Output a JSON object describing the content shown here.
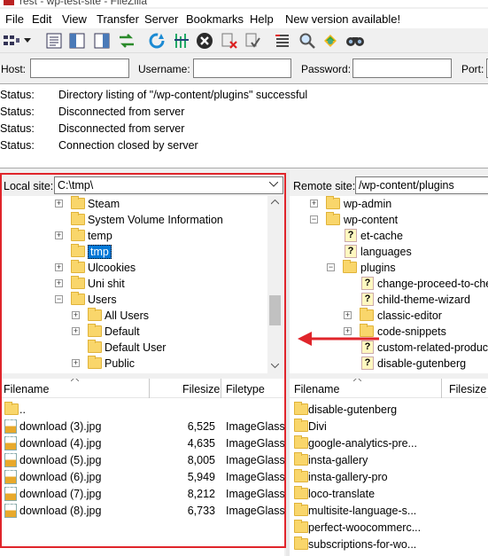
{
  "titlebar": {
    "title": "rest - wp-test-site - FileZilla"
  },
  "menu": [
    "File",
    "Edit",
    "View",
    "Transfer",
    "Server",
    "Bookmarks",
    "Help",
    "New version available!"
  ],
  "toolbar_icons": [
    "site-manager-icon",
    "dropdown-arrow-icon",
    "toggle-message-log-icon",
    "toggle-local-tree-icon",
    "toggle-remote-tree-icon",
    "toggle-transfer-queue-icon",
    "refresh-icon",
    "process-queue-icon",
    "cancel-icon",
    "disconnect-icon",
    "reconnect-icon",
    "directory-filter-icon",
    "toggle-sync-browsing-icon",
    "dir-comparison-icon",
    "search-remote-icon"
  ],
  "quickconnect": {
    "host_label": "Host:",
    "username_label": "Username:",
    "password_label": "Password:",
    "port_label": "Port:",
    "host_value": "",
    "username_value": "",
    "password_value": "",
    "port_value": ""
  },
  "log": [
    {
      "k": "Status:",
      "v": "Directory listing of \"/wp-content/plugins\" successful"
    },
    {
      "k": "Status:",
      "v": "Disconnected from server"
    },
    {
      "k": "Status:",
      "v": "Disconnected from server"
    },
    {
      "k": "Status:",
      "v": "Connection closed by server"
    }
  ],
  "local": {
    "site_label": "Local site:",
    "path": "C:\\tmp\\",
    "tree": [
      {
        "name": "Steam",
        "expander": "+",
        "indent": 0
      },
      {
        "name": "System Volume Information",
        "expander": "",
        "indent": 0
      },
      {
        "name": "temp",
        "expander": "+",
        "indent": 0
      },
      {
        "name": "tmp",
        "expander": "",
        "indent": 0,
        "selected": true
      },
      {
        "name": "Ulcookies",
        "expander": "+",
        "indent": 0
      },
      {
        "name": "Uni shit",
        "expander": "+",
        "indent": 0
      },
      {
        "name": "Users",
        "expander": "−",
        "indent": 0
      },
      {
        "name": "All Users",
        "expander": "+",
        "indent": 1
      },
      {
        "name": "Default",
        "expander": "+",
        "indent": 1
      },
      {
        "name": "Default User",
        "expander": "",
        "indent": 1
      },
      {
        "name": "Public",
        "expander": "+",
        "indent": 1
      }
    ],
    "columns": {
      "filename": "Filename",
      "filesize": "Filesize",
      "filetype": "Filetype"
    },
    "files": [
      {
        "name": "..",
        "size": "",
        "type": "",
        "kind": "folder"
      },
      {
        "name": "download (3).jpg",
        "size": "6,525",
        "type": "ImageGlass",
        "kind": "jpg"
      },
      {
        "name": "download (4).jpg",
        "size": "4,635",
        "type": "ImageGlass",
        "kind": "jpg"
      },
      {
        "name": "download (5).jpg",
        "size": "8,005",
        "type": "ImageGlass",
        "kind": "jpg"
      },
      {
        "name": "download (6).jpg",
        "size": "5,949",
        "type": "ImageGlass",
        "kind": "jpg"
      },
      {
        "name": "download (7).jpg",
        "size": "8,212",
        "type": "ImageGlass",
        "kind": "jpg"
      },
      {
        "name": "download (8).jpg",
        "size": "6,733",
        "type": "ImageGlass",
        "kind": "jpg"
      }
    ]
  },
  "remote": {
    "site_label": "Remote site:",
    "path": "/wp-content/plugins",
    "tree": [
      {
        "name": "wp-admin",
        "expander": "+",
        "indent": 0,
        "icon": "folder"
      },
      {
        "name": "wp-content",
        "expander": "−",
        "indent": 0,
        "icon": "folder"
      },
      {
        "name": "et-cache",
        "expander": "",
        "indent": 1,
        "icon": "unknown"
      },
      {
        "name": "languages",
        "expander": "",
        "indent": 1,
        "icon": "unknown"
      },
      {
        "name": "plugins",
        "expander": "−",
        "indent": 1,
        "icon": "folder"
      },
      {
        "name": "change-proceed-to-che",
        "expander": "",
        "indent": 2,
        "icon": "unknown"
      },
      {
        "name": "child-theme-wizard",
        "expander": "",
        "indent": 2,
        "icon": "unknown"
      },
      {
        "name": "classic-editor",
        "expander": "+",
        "indent": 2,
        "icon": "folder"
      },
      {
        "name": "code-snippets",
        "expander": "+",
        "indent": 2,
        "icon": "folder"
      },
      {
        "name": "custom-related-product",
        "expander": "",
        "indent": 2,
        "icon": "unknown"
      },
      {
        "name": "disable-gutenberg",
        "expander": "",
        "indent": 2,
        "icon": "unknown"
      }
    ],
    "columns": {
      "filename": "Filename",
      "filesize": "Filesize"
    },
    "files": [
      "disable-gutenberg",
      "Divi",
      "google-analytics-pre...",
      "insta-gallery",
      "insta-gallery-pro",
      "loco-translate",
      "multisite-language-s...",
      "perfect-woocommerc...",
      "subscriptions-for-wo..."
    ]
  },
  "colors": {
    "highlight": "#e0252b",
    "selection": "#0078d7",
    "folder": "#f9d66b"
  }
}
